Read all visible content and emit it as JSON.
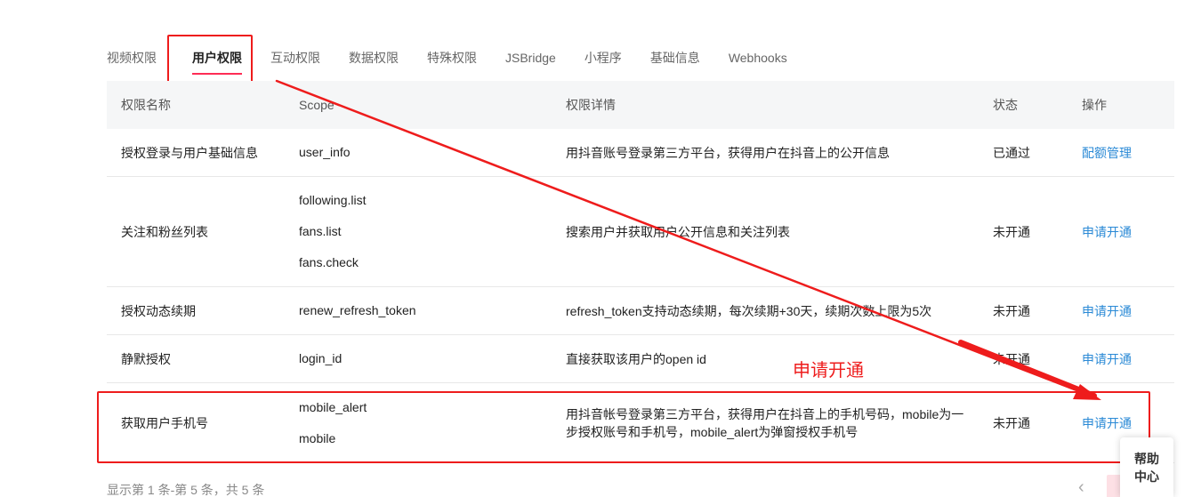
{
  "tabs": [
    "视频权限",
    "用户权限",
    "互动权限",
    "数据权限",
    "特殊权限",
    "JSBridge",
    "小程序",
    "基础信息",
    "Webhooks"
  ],
  "active_tab": "用户权限",
  "table": {
    "headers": [
      "权限名称",
      "Scope",
      "权限详情",
      "状态",
      "操作"
    ],
    "rows": [
      {
        "name": "授权登录与用户基础信息",
        "scopes": [
          "user_info"
        ],
        "detail": "用抖音账号登录第三方平台，获得用户在抖音上的公开信息",
        "status": "已通过",
        "action": "配额管理"
      },
      {
        "name": "关注和粉丝列表",
        "scopes": [
          "following.list",
          "fans.list",
          "fans.check"
        ],
        "detail": "搜索用户并获取用户公开信息和关注列表",
        "status": "未开通",
        "action": "申请开通"
      },
      {
        "name": "授权动态续期",
        "scopes": [
          "renew_refresh_token"
        ],
        "detail": "refresh_token支持动态续期，每次续期+30天，续期次数上限为5次",
        "status": "未开通",
        "action": "申请开通"
      },
      {
        "name": "静默授权",
        "scopes": [
          "login_id"
        ],
        "detail": "直接获取该用户的open id",
        "status": "未开通",
        "action": "申请开通"
      },
      {
        "name": "获取用户手机号",
        "scopes": [
          "mobile_alert",
          "mobile"
        ],
        "detail": "用抖音帐号登录第三方平台，获得用户在抖音上的手机号码，mobile为一步授权账号和手机号，mobile_alert为弹窗授权手机号",
        "status": "未开通",
        "action": "申请开通"
      }
    ]
  },
  "annotation": {
    "text": "申请开通",
    "color": "#ee1c1c"
  },
  "pagination": {
    "info": "显示第 1 条-第 5 条，共 5 条",
    "prev_icon": "chevron-left-icon"
  },
  "help": {
    "line1": "帮助",
    "line2": "中心"
  },
  "colors": {
    "link": "#2b8ad6",
    "active_tab_underline": "#fe2c55",
    "annotation": "#ee1c1c"
  }
}
